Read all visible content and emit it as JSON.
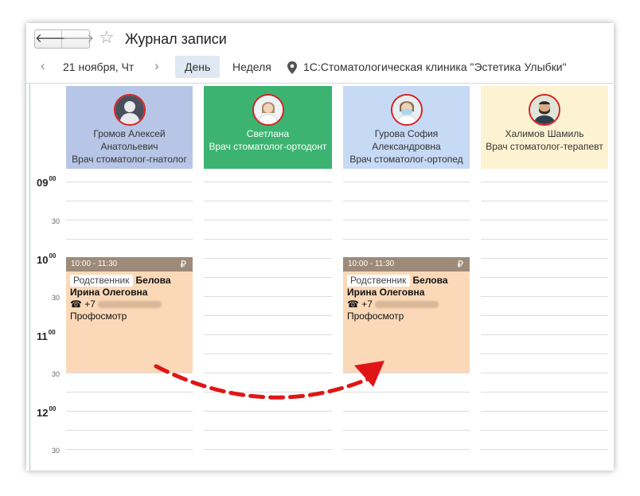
{
  "window": {
    "title": "Журнал записи",
    "nav_back": "🡐",
    "nav_forward": "🡒",
    "favorite": "☆"
  },
  "toolbar": {
    "prev": "‹",
    "date": "21 ноября, Чт",
    "next": "›",
    "tab_day": "День",
    "tab_week": "Неделя",
    "clinic": "1С:Стоматологическая клиника \"Эстетика Улыбки\""
  },
  "timeline": {
    "h09": "09",
    "h10": "10",
    "h11": "11",
    "h12": "12",
    "minutes_00": "00",
    "minutes_30": "30"
  },
  "doctors": [
    {
      "name_line1": "Громов Алексей",
      "name_line2": "Анатольевич",
      "role": "Врач стоматолог-гнатолог",
      "color": "#b7c6e6",
      "avatar": "person-silhouette-icon"
    },
    {
      "name_line1": "Светлана",
      "name_line2": "",
      "role": "Врач стоматолог-ортодонт",
      "color": "#3cb371",
      "avatar": "doctor-woman-photo"
    },
    {
      "name_line1": "Гурова София",
      "name_line2": "Александровна",
      "role": "Врач стоматолог-ортопед",
      "color": "#c6d9f5",
      "avatar": "doctor-mask-photo"
    },
    {
      "name_line1": "Халимов Шамиль",
      "name_line2": "",
      "role": "Врач стоматолог-терапевт",
      "color": "#fdf3d2",
      "avatar": "doctor-man-photo"
    }
  ],
  "appointments": [
    {
      "time": "10:00 - 11:30",
      "currency": "₽",
      "badge": "Родственник",
      "surname": "Белова",
      "given": "Ирина Олеговна",
      "phone_icon": "☎",
      "phone_prefix": "+7",
      "service": "Профосмотр"
    },
    {
      "time": "10:00 - 11:30",
      "currency": "₽",
      "badge": "Родственник",
      "surname": "Белова",
      "given": "Ирина Олеговна",
      "phone_icon": "☎",
      "phone_prefix": "+7",
      "service": "Профосмотр"
    }
  ],
  "colors": {
    "appointment_bg": "#fbd9b8",
    "appointment_header": "#9e8a79",
    "arrow": "#e01515",
    "avatar_ring": "#d92121"
  }
}
